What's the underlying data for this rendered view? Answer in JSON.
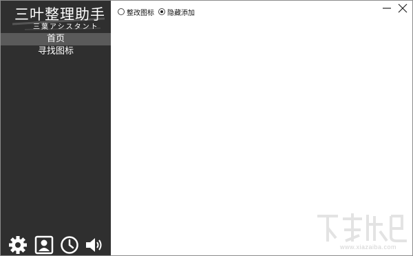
{
  "app": {
    "title": "三叶整理助手",
    "subtitle": "三葉アシスタント"
  },
  "sidebar": {
    "items": [
      {
        "label": "首页",
        "active": true
      },
      {
        "label": "寻找图标",
        "active": false
      }
    ],
    "bottom_icons": [
      "gear-icon",
      "user-card-icon",
      "clock-icon",
      "speaker-icon"
    ]
  },
  "options": {
    "radio_1_label": "整改图标",
    "radio_1_checked": false,
    "radio_2_label": "隐藏添加",
    "radio_2_checked": true
  },
  "watermark": {
    "site": "www.xiazaiba.com"
  },
  "colors": {
    "sidebar_bg": "#2f2f2f",
    "active_item_bg": "#5a5a5a",
    "content_bg": "#ffffff"
  }
}
